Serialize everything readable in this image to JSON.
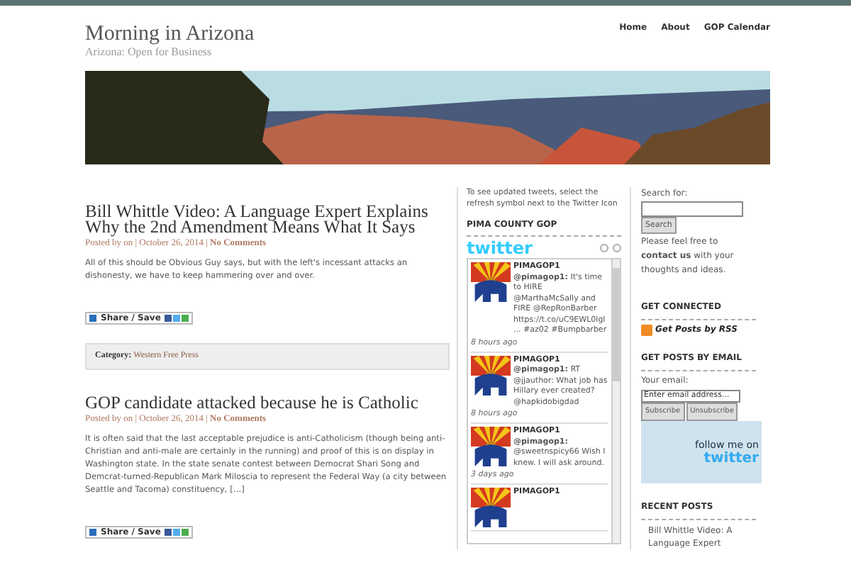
{
  "nav": [
    {
      "label": "Home"
    },
    {
      "label": "About"
    },
    {
      "label": "GOP Calendar"
    }
  ],
  "site": {
    "title": "Morning in Arizona",
    "tagline": "Arizona: Open for Business"
  },
  "meta_separator": "|",
  "posts": [
    {
      "title": "Bill Whittle Video: A Language Expert Explains Why the 2nd Amendment Means What It Says",
      "posted_by": "Posted by on",
      "date": "October 26, 2014",
      "comments": "No Comments",
      "excerpt": "All of this should be Obvious Guy says, but with the left's incessant attacks an dishonesty, we have to keep hammering over and over.",
      "share": "Share / Save",
      "category_label": "Category:",
      "category": "Western Free Press"
    },
    {
      "title": "GOP candidate attacked because he is Catholic",
      "posted_by": "Posted by on",
      "date": "October 26, 2014",
      "comments": "No Comments",
      "excerpt": "It is often said that the last acceptable prejudice is anti-Catholicism (though being anti-Christian and anti-male are certainly in the running) and proof of this is on display in Washington state. In the state senate contest between Democrat Shari Song and Demcrat-turned-Republican Mark Miloscia to represent the Federal Way (a city between Seattle and Tacoma) constituency, […]",
      "share": "Share / Save"
    }
  ],
  "twitter_widget": {
    "intro": "To see updated tweets, select the refresh symbol next to the Twitter Icon",
    "heading": "PIMA COUNTY GOP",
    "logo": "twitter",
    "tweets": [
      {
        "user": "PIMAGOP1",
        "text": "**@pimagop1:** It's time to HIRE @MarthaMcSally and FIRE @RepRonBarber https://t.co/uC9EWL0lgl ... #az02 #Bumpbarber",
        "time": "8 hours ago"
      },
      {
        "user": "PIMAGOP1",
        "text": "**@pimagop1:** RT @jjauthor: What job has Hillary ever created? @hapkidobigdad",
        "time": "8 hours ago"
      },
      {
        "user": "PIMAGOP1",
        "text": "**@pimagop1:** @sweetnspicy66 Wish I knew. I will ask around.",
        "time": "3 days ago"
      },
      {
        "user": "PIMAGOP1"
      }
    ]
  },
  "sidebar": {
    "search_label": "Search for:",
    "search_button": "Search",
    "contact": "Please feel free to **contact us** with your thoughts and ideas.",
    "connected_heading": "GET CONNECTED",
    "rss_link": "Get Posts by RSS",
    "email_heading": "GET POSTS BY EMAIL",
    "email_label": "Your email:",
    "email_placeholder": "Enter email address...",
    "subscribe": "Subscribe",
    "unsubscribe": "Unsubscribe",
    "follow_badge": [
      "follow me on",
      "twitter"
    ],
    "recent_heading": "RECENT POSTS",
    "recent_posts": [
      "Bill Whittle Video: A Language Expert"
    ]
  }
}
